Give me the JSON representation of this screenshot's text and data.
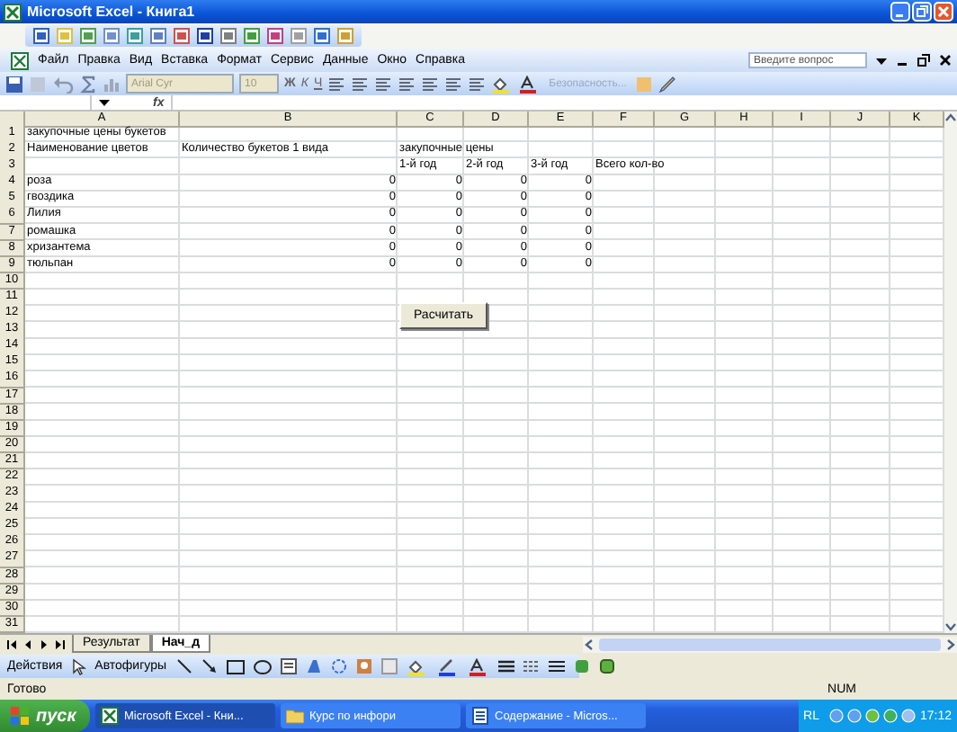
{
  "window": {
    "title": "Microsoft Excel - Книга1"
  },
  "menu": {
    "items": [
      "Файл",
      "Правка",
      "Вид",
      "Вставка",
      "Формат",
      "Сервис",
      "Данные",
      "Окно",
      "Справка"
    ],
    "help_search": {
      "placeholder": "Введите вопрос"
    }
  },
  "formatting_toolbar": {
    "font": {
      "value": "Arial Cyr",
      "disabled": true
    },
    "size": {
      "value": "10",
      "disabled": true
    },
    "style_buttons": [
      "Ж",
      "К",
      "Ч"
    ],
    "security": {
      "label": "Безопасность...",
      "disabled": true
    }
  },
  "formula_bar": {
    "label": "fx"
  },
  "sheet": {
    "columns": [
      "A",
      "B",
      "C",
      "D",
      "E",
      "F",
      "G",
      "H",
      "I",
      "J",
      "K"
    ],
    "rows": [
      {
        "header": "1",
        "cells": [
          {
            "text": "закупочные цены букетов",
            "kind": "text"
          }
        ]
      },
      {
        "header": "2",
        "cells": [
          {
            "text": "Наименование цветов",
            "kind": "text"
          },
          {
            "text": "Количество букетов 1 вида",
            "kind": "text"
          },
          {
            "text": "закупочные цены",
            "kind": "text"
          }
        ]
      },
      {
        "header": "3",
        "cells": [
          null,
          null,
          {
            "text": "1-й год",
            "kind": "text"
          },
          {
            "text": "2-й год",
            "kind": "text"
          },
          {
            "text": "3-й год",
            "kind": "text"
          },
          {
            "text": "Всего кол-во",
            "kind": "text"
          }
        ]
      },
      {
        "header": "4",
        "cells": [
          {
            "text": "роза",
            "kind": "text"
          },
          {
            "text": "0",
            "kind": "number"
          },
          {
            "text": "0",
            "kind": "number"
          },
          {
            "text": "0",
            "kind": "number"
          },
          {
            "text": "0",
            "kind": "number"
          }
        ]
      },
      {
        "header": "5",
        "cells": [
          {
            "text": "гвоздика",
            "kind": "text"
          },
          {
            "text": "0",
            "kind": "number"
          },
          {
            "text": "0",
            "kind": "number"
          },
          {
            "text": "0",
            "kind": "number"
          },
          {
            "text": "0",
            "kind": "number"
          }
        ]
      },
      {
        "header": "6",
        "cells": [
          {
            "text": "Лилия",
            "kind": "text"
          },
          {
            "text": "0",
            "kind": "number"
          },
          {
            "text": "0",
            "kind": "number"
          },
          {
            "text": "0",
            "kind": "number"
          },
          {
            "text": "0",
            "kind": "number"
          }
        ]
      },
      {
        "header": "7",
        "cells": [
          {
            "text": "ромашка",
            "kind": "text"
          },
          {
            "text": "0",
            "kind": "number"
          },
          {
            "text": "0",
            "kind": "number"
          },
          {
            "text": "0",
            "kind": "number"
          },
          {
            "text": "0",
            "kind": "number"
          }
        ]
      },
      {
        "header": "8",
        "cells": [
          {
            "text": "хризантема",
            "kind": "text"
          },
          {
            "text": "0",
            "kind": "number"
          },
          {
            "text": "0",
            "kind": "number"
          },
          {
            "text": "0",
            "kind": "number"
          },
          {
            "text": "0",
            "kind": "number"
          }
        ]
      },
      {
        "header": "9",
        "cells": [
          {
            "text": "тюльпан",
            "kind": "text"
          },
          {
            "text": "0",
            "kind": "number"
          },
          {
            "text": "0",
            "kind": "number"
          },
          {
            "text": "0",
            "kind": "number"
          },
          {
            "text": "0",
            "kind": "number"
          }
        ]
      },
      {
        "header": "10"
      },
      {
        "header": "11"
      },
      {
        "header": "12"
      },
      {
        "header": "13"
      },
      {
        "header": "14"
      },
      {
        "header": "15"
      },
      {
        "header": "16"
      },
      {
        "header": "17"
      },
      {
        "header": "18"
      },
      {
        "header": "19"
      },
      {
        "header": "20"
      },
      {
        "header": "21"
      },
      {
        "header": "22"
      },
      {
        "header": "23"
      },
      {
        "header": "24"
      },
      {
        "header": "25"
      },
      {
        "header": "26"
      },
      {
        "header": "27"
      },
      {
        "header": "28"
      },
      {
        "header": "29"
      },
      {
        "header": "30"
      },
      {
        "header": "31"
      }
    ]
  },
  "button": {
    "label": "Расчитать"
  },
  "sheet_tabs": [
    {
      "label": "Результат",
      "selected": false
    },
    {
      "label": "Нач_д",
      "selected": true
    }
  ],
  "drawing_toolbar": {
    "actions": "Действия",
    "autoshapes": "Автофигуры"
  },
  "status_bar": {
    "text": "Готово",
    "indicator": "NUM"
  },
  "taskbar": {
    "start": "пуск",
    "tasks": [
      {
        "label": "Microsoft Excel - Кни...",
        "selected": true
      },
      {
        "label": "Курс по инфори",
        "selected": false
      },
      {
        "label": "Содержание - Micros...",
        "selected": false
      }
    ],
    "language": "RL",
    "clock": "17:12"
  }
}
